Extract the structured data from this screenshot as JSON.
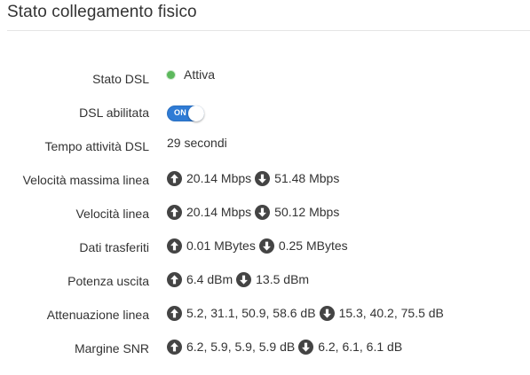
{
  "panel": {
    "title": "Stato collegamento fisico"
  },
  "rows": {
    "dsl_status": {
      "label": "Stato DSL",
      "value": "Attiva",
      "status_color": "#5cb85c"
    },
    "dsl_enabled": {
      "label": "DSL abilitata",
      "toggle_label": "ON",
      "toggle_state": "on",
      "toggle_color": "#2f7bd5"
    },
    "uptime": {
      "label": "Tempo attività DSL",
      "value": "29 secondi"
    },
    "max_speed": {
      "label": "Velocità massima linea",
      "up": "20.14 Mbps",
      "down": "51.48 Mbps"
    },
    "speed": {
      "label": "Velocità linea",
      "up": "20.14 Mbps",
      "down": "50.12 Mbps"
    },
    "data": {
      "label": "Dati trasferiti",
      "up": "0.01 MBytes",
      "down": "0.25 MBytes"
    },
    "power": {
      "label": "Potenza uscita",
      "up": "6.4 dBm",
      "down": "13.5 dBm"
    },
    "attenuation": {
      "label": "Attenuazione linea",
      "up": "5.2, 31.1, 50.9, 58.6 dB",
      "down": "15.3, 40.2, 75.5 dB"
    },
    "snr": {
      "label": "Margine SNR",
      "up": "6.2, 5.9, 5.9, 5.9 dB",
      "down": "6.2, 6.1, 6.1 dB"
    }
  },
  "icons": {
    "upload": "arrow-up-circle-icon",
    "download": "arrow-down-circle-icon",
    "icon_color": "#444444"
  }
}
